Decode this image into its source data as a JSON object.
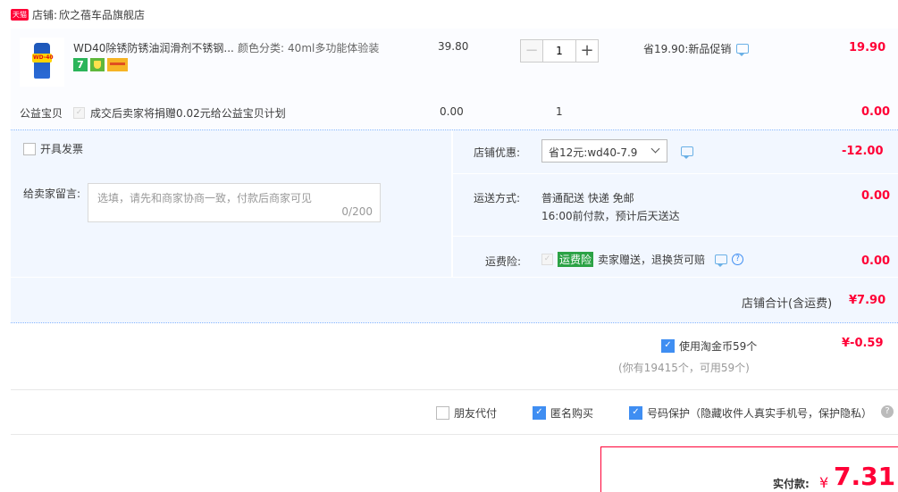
{
  "shop": {
    "badge": "天猫",
    "label": "店铺:",
    "name": "欣之蓓车品旗舰店"
  },
  "product": {
    "title": "WD40除锈防锈油润滑剂不锈钢...",
    "spec_label": "颜色分类:",
    "spec_value": "40ml多功能体验装",
    "price": "39.80",
    "quantity": "1",
    "promo": "省19.90:新品促销",
    "subtotal": "19.90",
    "badge_7day": "7",
    "thumb_brand": "WD-40"
  },
  "charity": {
    "label": "公益宝贝",
    "text": "成交后卖家将捐赠0.02元给公益宝贝计划",
    "price": "0.00",
    "quantity": "1",
    "subtotal": "0.00"
  },
  "invoice": {
    "label": "开具发票"
  },
  "message": {
    "label": "给卖家留言:",
    "placeholder": "选填，请先和商家协商一致，付款后商家可见",
    "counter": "0/200"
  },
  "shop_discount": {
    "label": "店铺优惠:",
    "selected": "省12元:wd40-7.9",
    "amount": "-12.00"
  },
  "shipping": {
    "label": "运送方式:",
    "line1": "普通配送 快递 免邮",
    "line2": "16:00前付款，预计后天送达",
    "amount": "0.00"
  },
  "insurance": {
    "label": "运费险:",
    "tag": "运费险",
    "text": "卖家赠送，退换货可赔",
    "amount": "0.00"
  },
  "shop_total": {
    "label": "店铺合计(含运费)",
    "amount": "¥7.90"
  },
  "coins": {
    "label": "使用淘金币59个",
    "amount": "¥-0.59",
    "sub": "(你有19415个，可用59个)"
  },
  "options": {
    "friend_pay": "朋友代付",
    "anonymous": "匿名购买",
    "number_protect": "号码保护（隐藏收件人真实手机号，保护隐私）"
  },
  "pay": {
    "label": "实付款:",
    "currency": "¥",
    "amount": "7.31"
  },
  "colors": {
    "price_red": "#ff0036",
    "checkbox_blue": "#3f8ef2",
    "tmall_red": "#ff0036",
    "insurance_green": "#2ba245"
  }
}
